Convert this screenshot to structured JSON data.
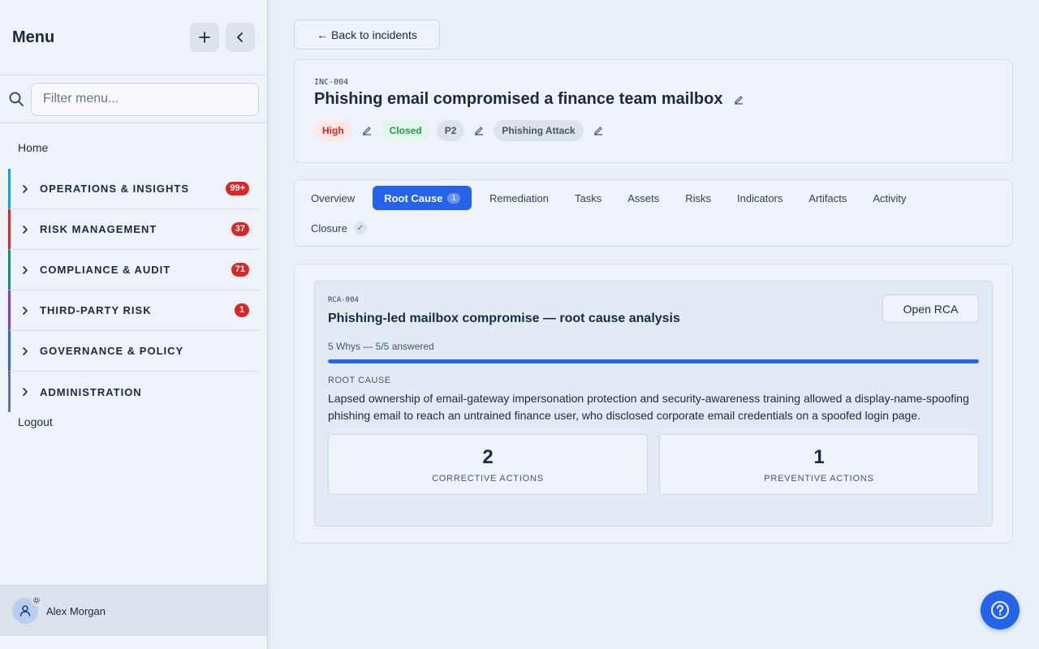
{
  "sidebar": {
    "title": "Menu",
    "filter_placeholder": "Filter menu...",
    "home_label": "Home",
    "groups": [
      {
        "label": "OPERATIONS & INSIGHTS",
        "badge": "99+",
        "color": "#0ea5e9"
      },
      {
        "label": "RISK MANAGEMENT",
        "badge": "37",
        "color": "#dc2626"
      },
      {
        "label": "COMPLIANCE & AUDIT",
        "badge": "71",
        "color": "#059669"
      },
      {
        "label": "THIRD-PARTY RISK",
        "badge": "1",
        "color": "#7c3aed"
      },
      {
        "label": "GOVERNANCE & POLICY",
        "badge": "",
        "color": "#2563eb"
      },
      {
        "label": "ADMINISTRATION",
        "badge": "",
        "color": "#64748b"
      }
    ],
    "logout_label": "Logout",
    "user_name": "Alex Morgan"
  },
  "incident": {
    "back_label": "← Back to incidents",
    "id": "INC-004",
    "title": "Phishing email compromised a finance team mailbox",
    "severity": "High",
    "status": "Closed",
    "priority": "P2",
    "category": "Phishing Attack"
  },
  "tabs": {
    "overview": "Overview",
    "root_cause": "Root Cause",
    "root_cause_count": "1",
    "remediation": "Remediation",
    "tasks": "Tasks",
    "assets": "Assets",
    "risks": "Risks",
    "indicators": "Indicators",
    "artifacts": "Artifacts",
    "activity": "Activity",
    "closure": "Closure",
    "closure_check": "✓"
  },
  "rca": {
    "id": "RCA-004",
    "title": "Phishing-led mailbox compromise — root cause analysis",
    "open_label": "Open RCA",
    "whys_text": "5 Whys — 5/5 answered",
    "whys_progress": 1.0,
    "root_cause_label": "ROOT CAUSE",
    "root_cause_text": "Lapsed ownership of email-gateway impersonation protection and security-awareness training allowed a display-name-spoofing phishing email to reach an untrained finance user, who disclosed corporate email credentials on a spoofed login page.",
    "corrective_count": "2",
    "corrective_label": "CORRECTIVE ACTIONS",
    "preventive_count": "1",
    "preventive_label": "PREVENTIVE ACTIONS"
  },
  "colors": {
    "accent": "#2563eb",
    "danger": "#dc2626",
    "success": "#16a34a"
  }
}
